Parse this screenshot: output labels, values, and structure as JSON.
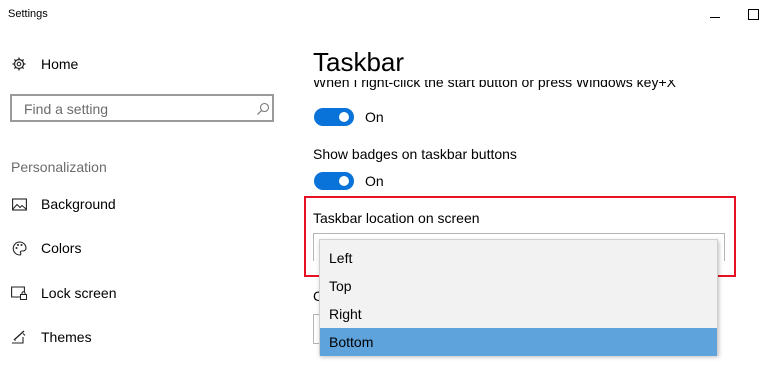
{
  "window": {
    "title": "Settings"
  },
  "sidebar": {
    "home_label": "Home",
    "search_placeholder": "Find a setting",
    "section_label": "Personalization",
    "items": [
      {
        "label": "Background",
        "icon": "picture-icon"
      },
      {
        "label": "Colors",
        "icon": "palette-icon"
      },
      {
        "label": "Lock screen",
        "icon": "lock-screen-icon"
      },
      {
        "label": "Themes",
        "icon": "brush-icon"
      }
    ]
  },
  "main": {
    "title": "Taskbar",
    "partial_setting_text": "When I right-click the start button or press Windows key+X",
    "toggle1": {
      "state_label": "On",
      "on": true
    },
    "setting2_label": "Show badges on taskbar buttons",
    "toggle2": {
      "state_label": "On",
      "on": true
    },
    "location_label": "Taskbar location on screen",
    "peek_char": "C",
    "dropdown": {
      "options": [
        "Left",
        "Top",
        "Right",
        "Bottom"
      ],
      "selected": "Bottom"
    }
  },
  "colors": {
    "accent": "#0a73d9",
    "selected_option": "#5fa3dd",
    "highlight_border": "#e81123"
  }
}
